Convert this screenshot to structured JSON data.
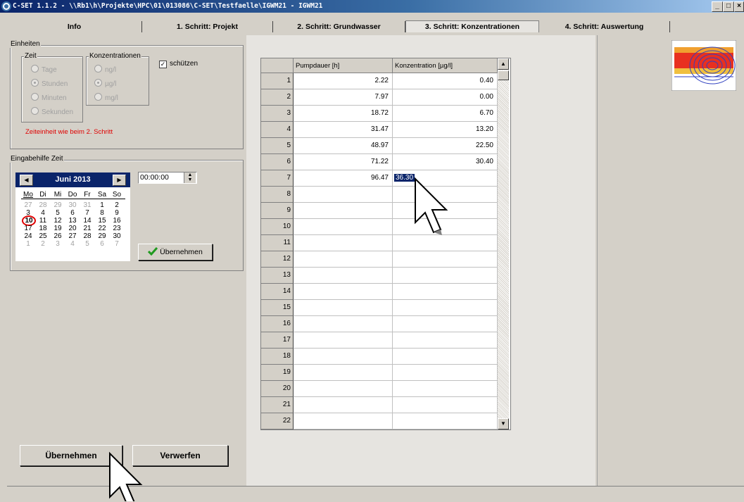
{
  "window": {
    "title": "C-SET 1.1.2 - \\\\Rb1\\h\\Projekte\\HPC\\01\\013086\\C-SET\\Testfaelle\\IGWM21 - IGWM21",
    "min": "_",
    "max": "□",
    "close": "×"
  },
  "tabs": [
    {
      "label": "Info"
    },
    {
      "label": "1. Schritt:  Projekt"
    },
    {
      "label": "2. Schritt: Grundwasser"
    },
    {
      "label": "3. Schritt: Konzentrationen",
      "active": true
    },
    {
      "label": "4. Schritt: Auswertung"
    }
  ],
  "units": {
    "title": "Einheiten",
    "time": {
      "label": "Zeit",
      "options": [
        "Tage",
        "Stunden",
        "Minuten",
        "Sekunden"
      ],
      "selected": "Stunden"
    },
    "conc": {
      "label": "Konzentrationen",
      "options": [
        "ng/l",
        "µg/l",
        "mg/l"
      ],
      "selected": "µg/l"
    },
    "protect_label": "schützen",
    "note": "Zeiteinheit wie beim 2. Schritt"
  },
  "time_helper": {
    "title": "Eingabehilfe Zeit",
    "month": "Juni 2013",
    "weekdays": [
      "Mo",
      "Di",
      "Mi",
      "Do",
      "Fr",
      "Sa",
      "So"
    ],
    "weeks": [
      [
        "27",
        "28",
        "29",
        "30",
        "31",
        "1",
        "2"
      ],
      [
        "3",
        "4",
        "5",
        "6",
        "7",
        "8",
        "9"
      ],
      [
        "10",
        "11",
        "12",
        "13",
        "14",
        "15",
        "16"
      ],
      [
        "17",
        "18",
        "19",
        "20",
        "21",
        "22",
        "23"
      ],
      [
        "24",
        "25",
        "26",
        "27",
        "28",
        "29",
        "30"
      ],
      [
        "1",
        "2",
        "3",
        "4",
        "5",
        "6",
        "7"
      ]
    ],
    "today": "10",
    "time_value": "00:00:00",
    "apply_label": "Übernehmen"
  },
  "table": {
    "headers": [
      "Pumpdauer [h]",
      "Konzentration [µg/l]"
    ],
    "rows": [
      {
        "n": "1",
        "dur": "2.22",
        "conc": "0.40"
      },
      {
        "n": "2",
        "dur": "7.97",
        "conc": "0.00"
      },
      {
        "n": "3",
        "dur": "18.72",
        "conc": "6.70"
      },
      {
        "n": "4",
        "dur": "31.47",
        "conc": "13.20"
      },
      {
        "n": "5",
        "dur": "48.97",
        "conc": "22.50"
      },
      {
        "n": "6",
        "dur": "71.22",
        "conc": "30.40"
      },
      {
        "n": "7",
        "dur": "96.47",
        "conc": "36.30"
      },
      {
        "n": "8",
        "dur": "",
        "conc": ""
      },
      {
        "n": "9",
        "dur": "",
        "conc": ""
      },
      {
        "n": "10",
        "dur": "",
        "conc": ""
      },
      {
        "n": "11",
        "dur": "",
        "conc": ""
      },
      {
        "n": "12",
        "dur": "",
        "conc": ""
      },
      {
        "n": "13",
        "dur": "",
        "conc": ""
      },
      {
        "n": "14",
        "dur": "",
        "conc": ""
      },
      {
        "n": "15",
        "dur": "",
        "conc": ""
      },
      {
        "n": "16",
        "dur": "",
        "conc": ""
      },
      {
        "n": "17",
        "dur": "",
        "conc": ""
      },
      {
        "n": "18",
        "dur": "",
        "conc": ""
      },
      {
        "n": "19",
        "dur": "",
        "conc": ""
      },
      {
        "n": "20",
        "dur": "",
        "conc": ""
      },
      {
        "n": "21",
        "dur": "",
        "conc": ""
      },
      {
        "n": "22",
        "dur": "",
        "conc": ""
      }
    ],
    "editing": {
      "row": "7",
      "value": "36.30"
    }
  },
  "footer": {
    "apply_label": "Übernehmen",
    "discard_label": "Verwerfen"
  }
}
